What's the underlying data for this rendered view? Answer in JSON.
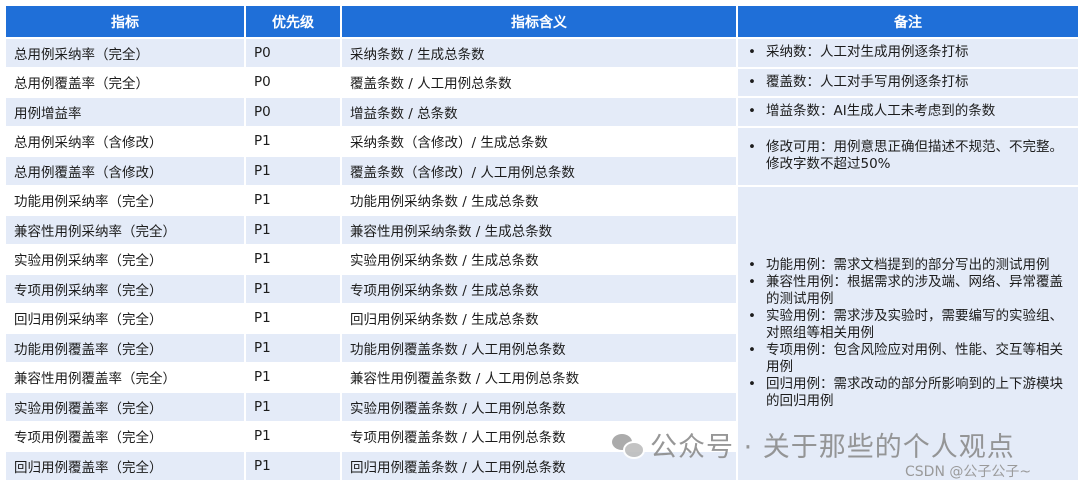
{
  "headers": {
    "metric": "指标",
    "priority": "优先级",
    "meaning": "指标含义",
    "remark": "备注"
  },
  "rows": [
    {
      "metric": "总用例采纳率（完全）",
      "priority": "P0",
      "meaning": "采纳条数 / 生成总条数"
    },
    {
      "metric": "总用例覆盖率（完全）",
      "priority": "P0",
      "meaning": "覆盖条数 / 人工用例总条数"
    },
    {
      "metric": "用例增益率",
      "priority": "P0",
      "meaning": "增益条数 / 总条数"
    },
    {
      "metric": "总用例采纳率（含修改）",
      "priority": "P1",
      "meaning": "采纳条数（含修改）/ 生成总条数"
    },
    {
      "metric": "总用例覆盖率（含修改）",
      "priority": "P1",
      "meaning": "覆盖条数（含修改）/ 人工用例总条数"
    },
    {
      "metric": "功能用例采纳率（完全）",
      "priority": "P1",
      "meaning": "功能用例采纳条数 / 生成总条数"
    },
    {
      "metric": "兼容性用例采纳率（完全）",
      "priority": "P1",
      "meaning": "兼容性用例采纳条数 / 生成总条数"
    },
    {
      "metric": "实验用例采纳率（完全）",
      "priority": "P1",
      "meaning": "实验用例采纳条数 / 生成总条数"
    },
    {
      "metric": "专项用例采纳率（完全）",
      "priority": "P1",
      "meaning": "专项用例采纳条数 / 生成总条数"
    },
    {
      "metric": "回归用例采纳率（完全）",
      "priority": "P1",
      "meaning": "回归用例采纳条数 / 生成总条数"
    },
    {
      "metric": "功能用例覆盖率（完全）",
      "priority": "P1",
      "meaning": "功能用例覆盖条数 / 人工用例总条数"
    },
    {
      "metric": "兼容性用例覆盖率（完全）",
      "priority": "P1",
      "meaning": "兼容性用例覆盖条数 / 人工用例总条数"
    },
    {
      "metric": "实验用例覆盖率（完全）",
      "priority": "P1",
      "meaning": "实验用例覆盖条数 / 人工用例总条数"
    },
    {
      "metric": "专项用例覆盖率（完全）",
      "priority": "P1",
      "meaning": "专项用例覆盖条数 / 人工用例总条数"
    },
    {
      "metric": "回归用例覆盖率（完全）",
      "priority": "P1",
      "meaning": "回归用例覆盖条数 / 人工用例总条数"
    }
  ],
  "notes": {
    "adopt": "采纳数：人工对生成用例逐条打标",
    "cover": "覆盖数：人工对手写用例逐条打标",
    "gain": "增益条数：AI生成人工未考虑到的条数",
    "modify": "修改可用：用例意思正确但描述不规范、不完整。修改字数不超过50%",
    "types": [
      "功能用例：需求文档提到的部分写出的测试用例",
      "兼容性用例：根据需求的涉及端、网络、异常覆盖的测试用例",
      "实验用例：需求涉及实验时，需要编写的实验组、对照组等相关用例",
      "专项用例：包含风险应对用例、性能、交互等相关用例",
      "回归用例：需求改动的部分所影响到的上下游模块的回归用例"
    ]
  },
  "watermark": {
    "text": "公众号 · 关于那些的个人观点",
    "csdn": "CSDN @公子公子~"
  }
}
